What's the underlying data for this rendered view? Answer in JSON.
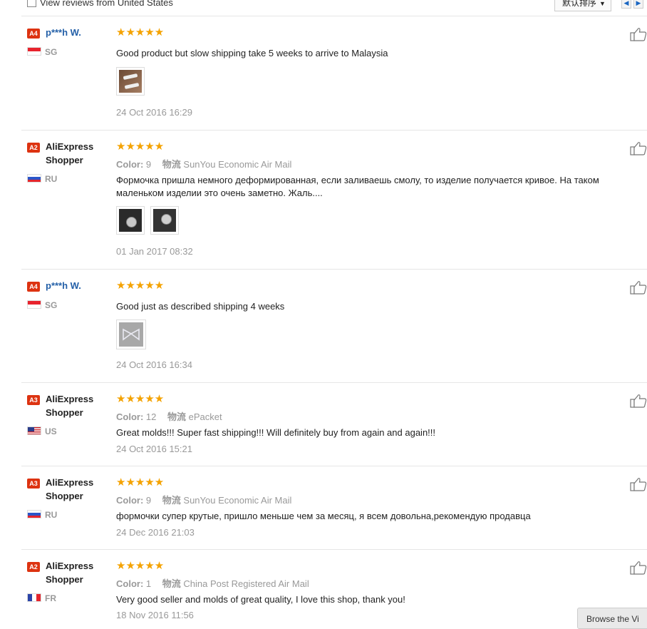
{
  "filter": {
    "view_us_label": "View reviews from United States",
    "sort_label": "默认排序"
  },
  "labels": {
    "color_key": "Color:",
    "shipping_key": "物流"
  },
  "reviews": [
    {
      "level": "A4",
      "user": "p***h W.",
      "country": "SG",
      "rating": 5,
      "stars": "★★★★★",
      "text": "Good product but slow shipping take 5 weeks to arrive to Malaysia",
      "date": "24 Oct 2016 16:29"
    },
    {
      "level": "A2",
      "user": "AliExpress Shopper",
      "country": "RU",
      "rating": 5,
      "stars": "★★★★★",
      "color": "9",
      "shipping": "SunYou Economic Air Mail",
      "text": "Формочка пришла немного деформированная, если заливаешь смолу, то изделие получается кривое. На таком маленьком изделии это очень заметно. Жаль....",
      "date": "01 Jan 2017 08:32"
    },
    {
      "level": "A4",
      "user": "p***h W.",
      "country": "SG",
      "rating": 5,
      "stars": "★★★★★",
      "text": "Good just as described shipping 4 weeks",
      "date": "24 Oct 2016 16:34"
    },
    {
      "level": "A3",
      "user": "AliExpress Shopper",
      "country": "US",
      "rating": 5,
      "stars": "★★★★★",
      "color": "12",
      "shipping": "ePacket",
      "text": "Great molds!!! Super fast shipping!!! Will definitely buy from again and again!!!",
      "date": "24 Oct 2016 15:21"
    },
    {
      "level": "A3",
      "user": "AliExpress Shopper",
      "country": "RU",
      "rating": 5,
      "stars": "★★★★★",
      "color": "9",
      "shipping": "SunYou Economic Air Mail",
      "text": "формочки супер крутые, пришло меньше чем за месяц, я всем довольна,рекомендую продавца",
      "date": "24 Dec 2016 21:03"
    },
    {
      "level": "A2",
      "user": "AliExpress Shopper",
      "country": "FR",
      "rating": 5,
      "stars": "★★★★★",
      "color": "1",
      "shipping": "China Post Registered Air Mail",
      "text": "Very good seller and molds of great quality, I love this shop, thank you!",
      "date": "18 Nov 2016 11:56"
    }
  ],
  "bottom_button": "Browse the Vi",
  "colors": {
    "star": "#f4a200",
    "level_badge": "#dd3311",
    "user_link": "#2460a8",
    "muted": "#999999"
  }
}
